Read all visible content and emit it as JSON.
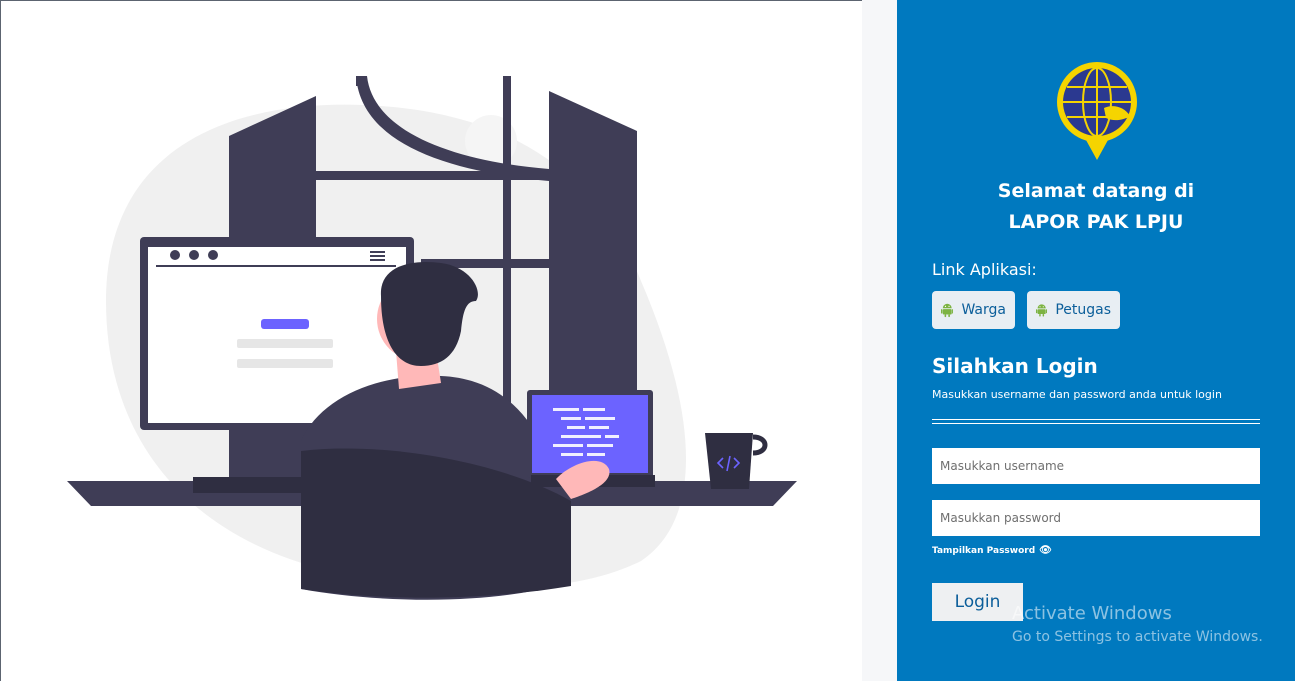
{
  "welcome": {
    "line1": "Selamat datang di",
    "line2": "LAPOR PAK LPJU"
  },
  "apps": {
    "label": "Link Aplikasi:",
    "warga": {
      "label": "Warga",
      "icon": "android-icon"
    },
    "petugas": {
      "label": "Petugas",
      "icon": "android-icon"
    }
  },
  "login": {
    "title": "Silahkan Login",
    "subtitle": "Masukkan username dan password anda untuk login",
    "username": {
      "placeholder": "Masukkan username",
      "value": ""
    },
    "password": {
      "placeholder": "Masukkan password",
      "value": ""
    },
    "show_password": "Tampilkan Password",
    "show_password_icon": "eye-icon",
    "button": "Login"
  },
  "watermark": {
    "title": "Activate Windows",
    "subtitle": "Go to Settings to activate Windows."
  },
  "colors": {
    "panel": "#0079bf",
    "android": "#7cb342",
    "logo_blue": "#2b3990",
    "logo_yellow": "#f5d400",
    "accent_purple": "#6c63ff"
  }
}
